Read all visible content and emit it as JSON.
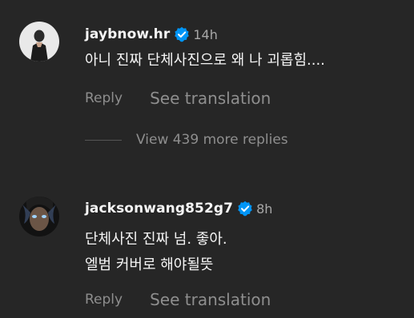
{
  "comments": [
    {
      "username": "jaybnow.hr",
      "time": "14h",
      "lines": [
        "아니 진짜 단체사진으로 왜 나 괴롭힘...."
      ],
      "reply_label": "Reply",
      "translate_label": "See translation"
    },
    {
      "username": "jacksonwang852g7",
      "time": "8h",
      "lines": [
        "단체사진 진짜 넘. 좋아.",
        "엘범 커버로 해야될뜻"
      ],
      "reply_label": "Reply",
      "translate_label": "See translation"
    }
  ],
  "view_replies_label": "View 439 more replies",
  "colors": {
    "background": "#262626",
    "primary_text": "#f5f5f5",
    "secondary_text": "#8e8e8e",
    "verified_badge": "#0095f6"
  },
  "icons": {
    "verified": "verified-badge-icon"
  }
}
